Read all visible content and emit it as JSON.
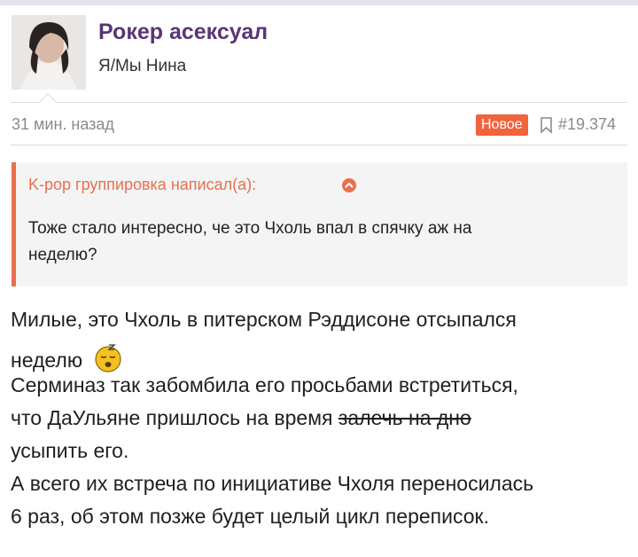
{
  "post": {
    "username": "Рокер асексуал",
    "user_title": "Я/Мы Нина",
    "time": "31 мин. назад",
    "badge": "Новое",
    "post_number": "#19.374"
  },
  "quote": {
    "author": "K-pop группировка написал(а):",
    "line1": "Тоже стало интересно, че это Чхоль впал в спячку аж на",
    "line2": "неделю?"
  },
  "body": {
    "line1": "Милые, это Чхоль в питерском Рэддисоне отсыпался",
    "line2": "неделю",
    "line3": "Серминаз так забомбила его просьбами встретиться,",
    "line4_before": "что ДаУльяне пришлось на время ",
    "line4_strike": "залечь на дно",
    "line5": "усыпить его.",
    "line6": "А всего их встреча по инициативе Чхоля переносилась",
    "line7": "6 раз, об этом позже будет целый цикл переписок."
  },
  "icons": {
    "bookmark": "bookmark-icon",
    "quote_jump": "arrow-up-circle-icon",
    "emoji": "sleeping-face-emoji"
  },
  "colors": {
    "username": "#5a3575",
    "accent": "#f0643c",
    "quote_border": "#e8704f"
  }
}
